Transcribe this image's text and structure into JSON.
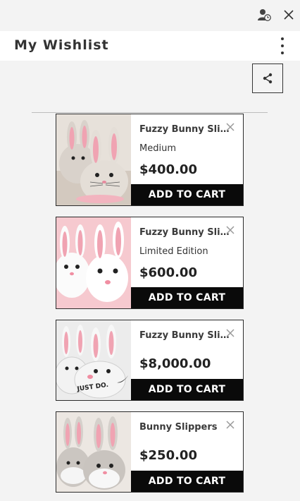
{
  "window": {
    "profile_icon": "profile-clock-icon",
    "close_icon": "close-icon"
  },
  "header": {
    "title": "My Wishlist",
    "menu_icon": "more-vertical-icon",
    "share_icon": "share-icon"
  },
  "items": [
    {
      "name": "Fuzzy Bunny Slippers",
      "variant": "Medium",
      "price": "$400.00",
      "cta": "ADD TO CART"
    },
    {
      "name": "Fuzzy Bunny Slippers",
      "variant": "Limited Edition",
      "price": "$600.00",
      "cta": "ADD TO CART"
    },
    {
      "name": "Fuzzy Bunny Slippers",
      "variant": "",
      "price": "$8,000.00",
      "cta": "ADD TO CART",
      "print": "JUST DO."
    },
    {
      "name": "Bunny Slippers",
      "variant": "",
      "price": "$250.00",
      "cta": "ADD TO CART"
    }
  ],
  "colors": {
    "background": "#f3f3f3",
    "button": "#0a0a0a",
    "fur_grey": "#d9d2cb",
    "fur_white": "#fbfbfb",
    "ear_pink": "#f0a3b2",
    "bg_pink": "#f6c9cf"
  }
}
